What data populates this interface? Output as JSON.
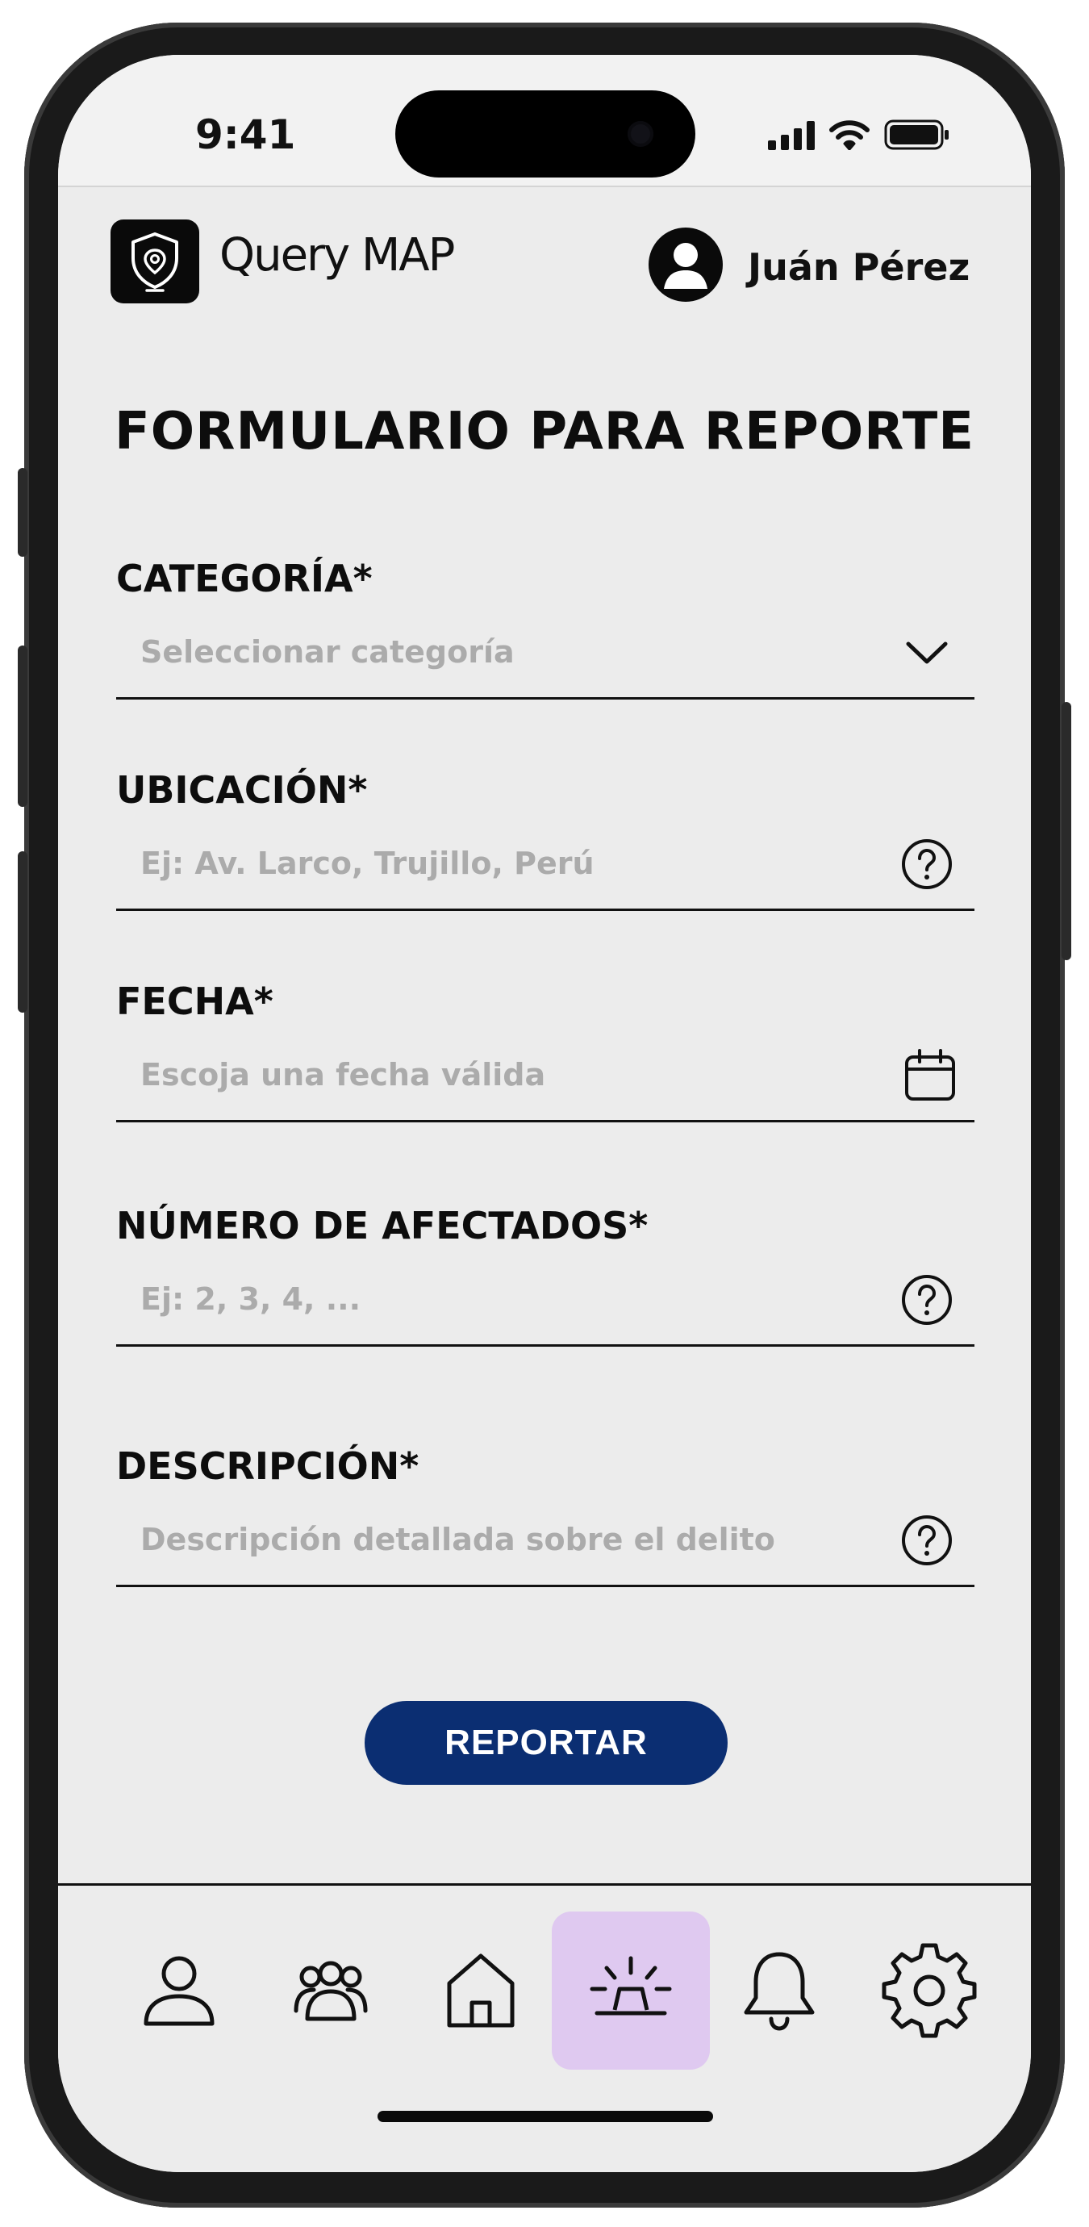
{
  "status_bar": {
    "time": "9:41"
  },
  "header": {
    "brand": "Query MAP",
    "user_name": "Juán Pérez"
  },
  "form": {
    "title": "FORMULARIO PARA REPORTE",
    "fields": [
      {
        "label": "CATEGORÍA*",
        "placeholder": "Seleccionar categoría",
        "icon": "chevron-down-icon"
      },
      {
        "label": "UBICACIÓN*",
        "placeholder": "Ej: Av. Larco, Trujillo, Perú",
        "icon": "help-circle-icon"
      },
      {
        "label": "FECHA*",
        "placeholder": "Escoja una fecha válida",
        "icon": "calendar-icon"
      },
      {
        "label": "NÚMERO DE AFECTADOS*",
        "placeholder": "Ej: 2, 3, 4, ...",
        "icon": "help-circle-icon"
      },
      {
        "label": "DESCRIPCIÓN*",
        "placeholder": "Descripción detallada sobre el delito",
        "icon": "help-circle-icon"
      }
    ],
    "submit_label": "REPORTAR"
  },
  "tabbar": {
    "items": [
      {
        "icon": "user-icon",
        "active": false
      },
      {
        "icon": "group-icon",
        "active": false
      },
      {
        "icon": "home-icon",
        "active": false
      },
      {
        "icon": "alarm-siren-icon",
        "active": true
      },
      {
        "icon": "bell-icon",
        "active": false
      },
      {
        "icon": "gear-icon",
        "active": false
      }
    ]
  },
  "colors": {
    "primary_button": "#0b2e72",
    "active_tab": "#dfc9f0",
    "screen_background": "#ececec",
    "placeholder_text": "#ababab"
  }
}
